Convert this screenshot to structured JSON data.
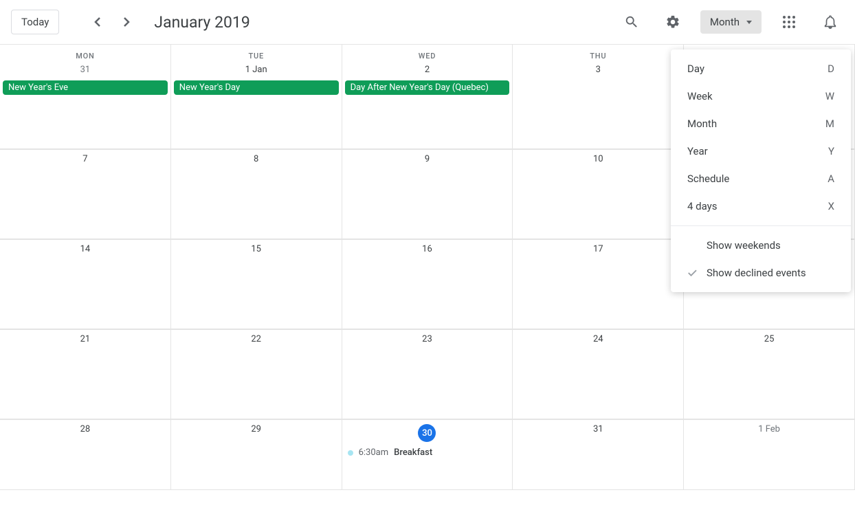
{
  "header": {
    "today_label": "Today",
    "title": "January 2019",
    "view_label": "Month"
  },
  "dropdown": {
    "items": [
      {
        "label": "Day",
        "shortcut": "D"
      },
      {
        "label": "Week",
        "shortcut": "W"
      },
      {
        "label": "Month",
        "shortcut": "M"
      },
      {
        "label": "Year",
        "shortcut": "Y"
      },
      {
        "label": "Schedule",
        "shortcut": "A"
      },
      {
        "label": "4 days",
        "shortcut": "X"
      }
    ],
    "toggles": [
      {
        "label": "Show weekends",
        "checked": false
      },
      {
        "label": "Show declined events",
        "checked": true
      }
    ]
  },
  "days": {
    "headers": [
      "MON",
      "TUE",
      "WED",
      "THU",
      ""
    ],
    "row0": [
      "31",
      "1 Jan",
      "2",
      "3",
      ""
    ],
    "row1": [
      "7",
      "8",
      "9",
      "10",
      ""
    ],
    "row2": [
      "14",
      "15",
      "16",
      "17",
      ""
    ],
    "row3": [
      "21",
      "22",
      "23",
      "24",
      "25"
    ],
    "row4": [
      "28",
      "29",
      "30",
      "31",
      "1 Feb"
    ]
  },
  "events": {
    "nye": "New Year's Eve",
    "nyd": "New Year's Day",
    "danyd": "Day After New Year's Day (Quebec)",
    "breakfast_time": "6:30am",
    "breakfast_title": "Breakfast"
  }
}
